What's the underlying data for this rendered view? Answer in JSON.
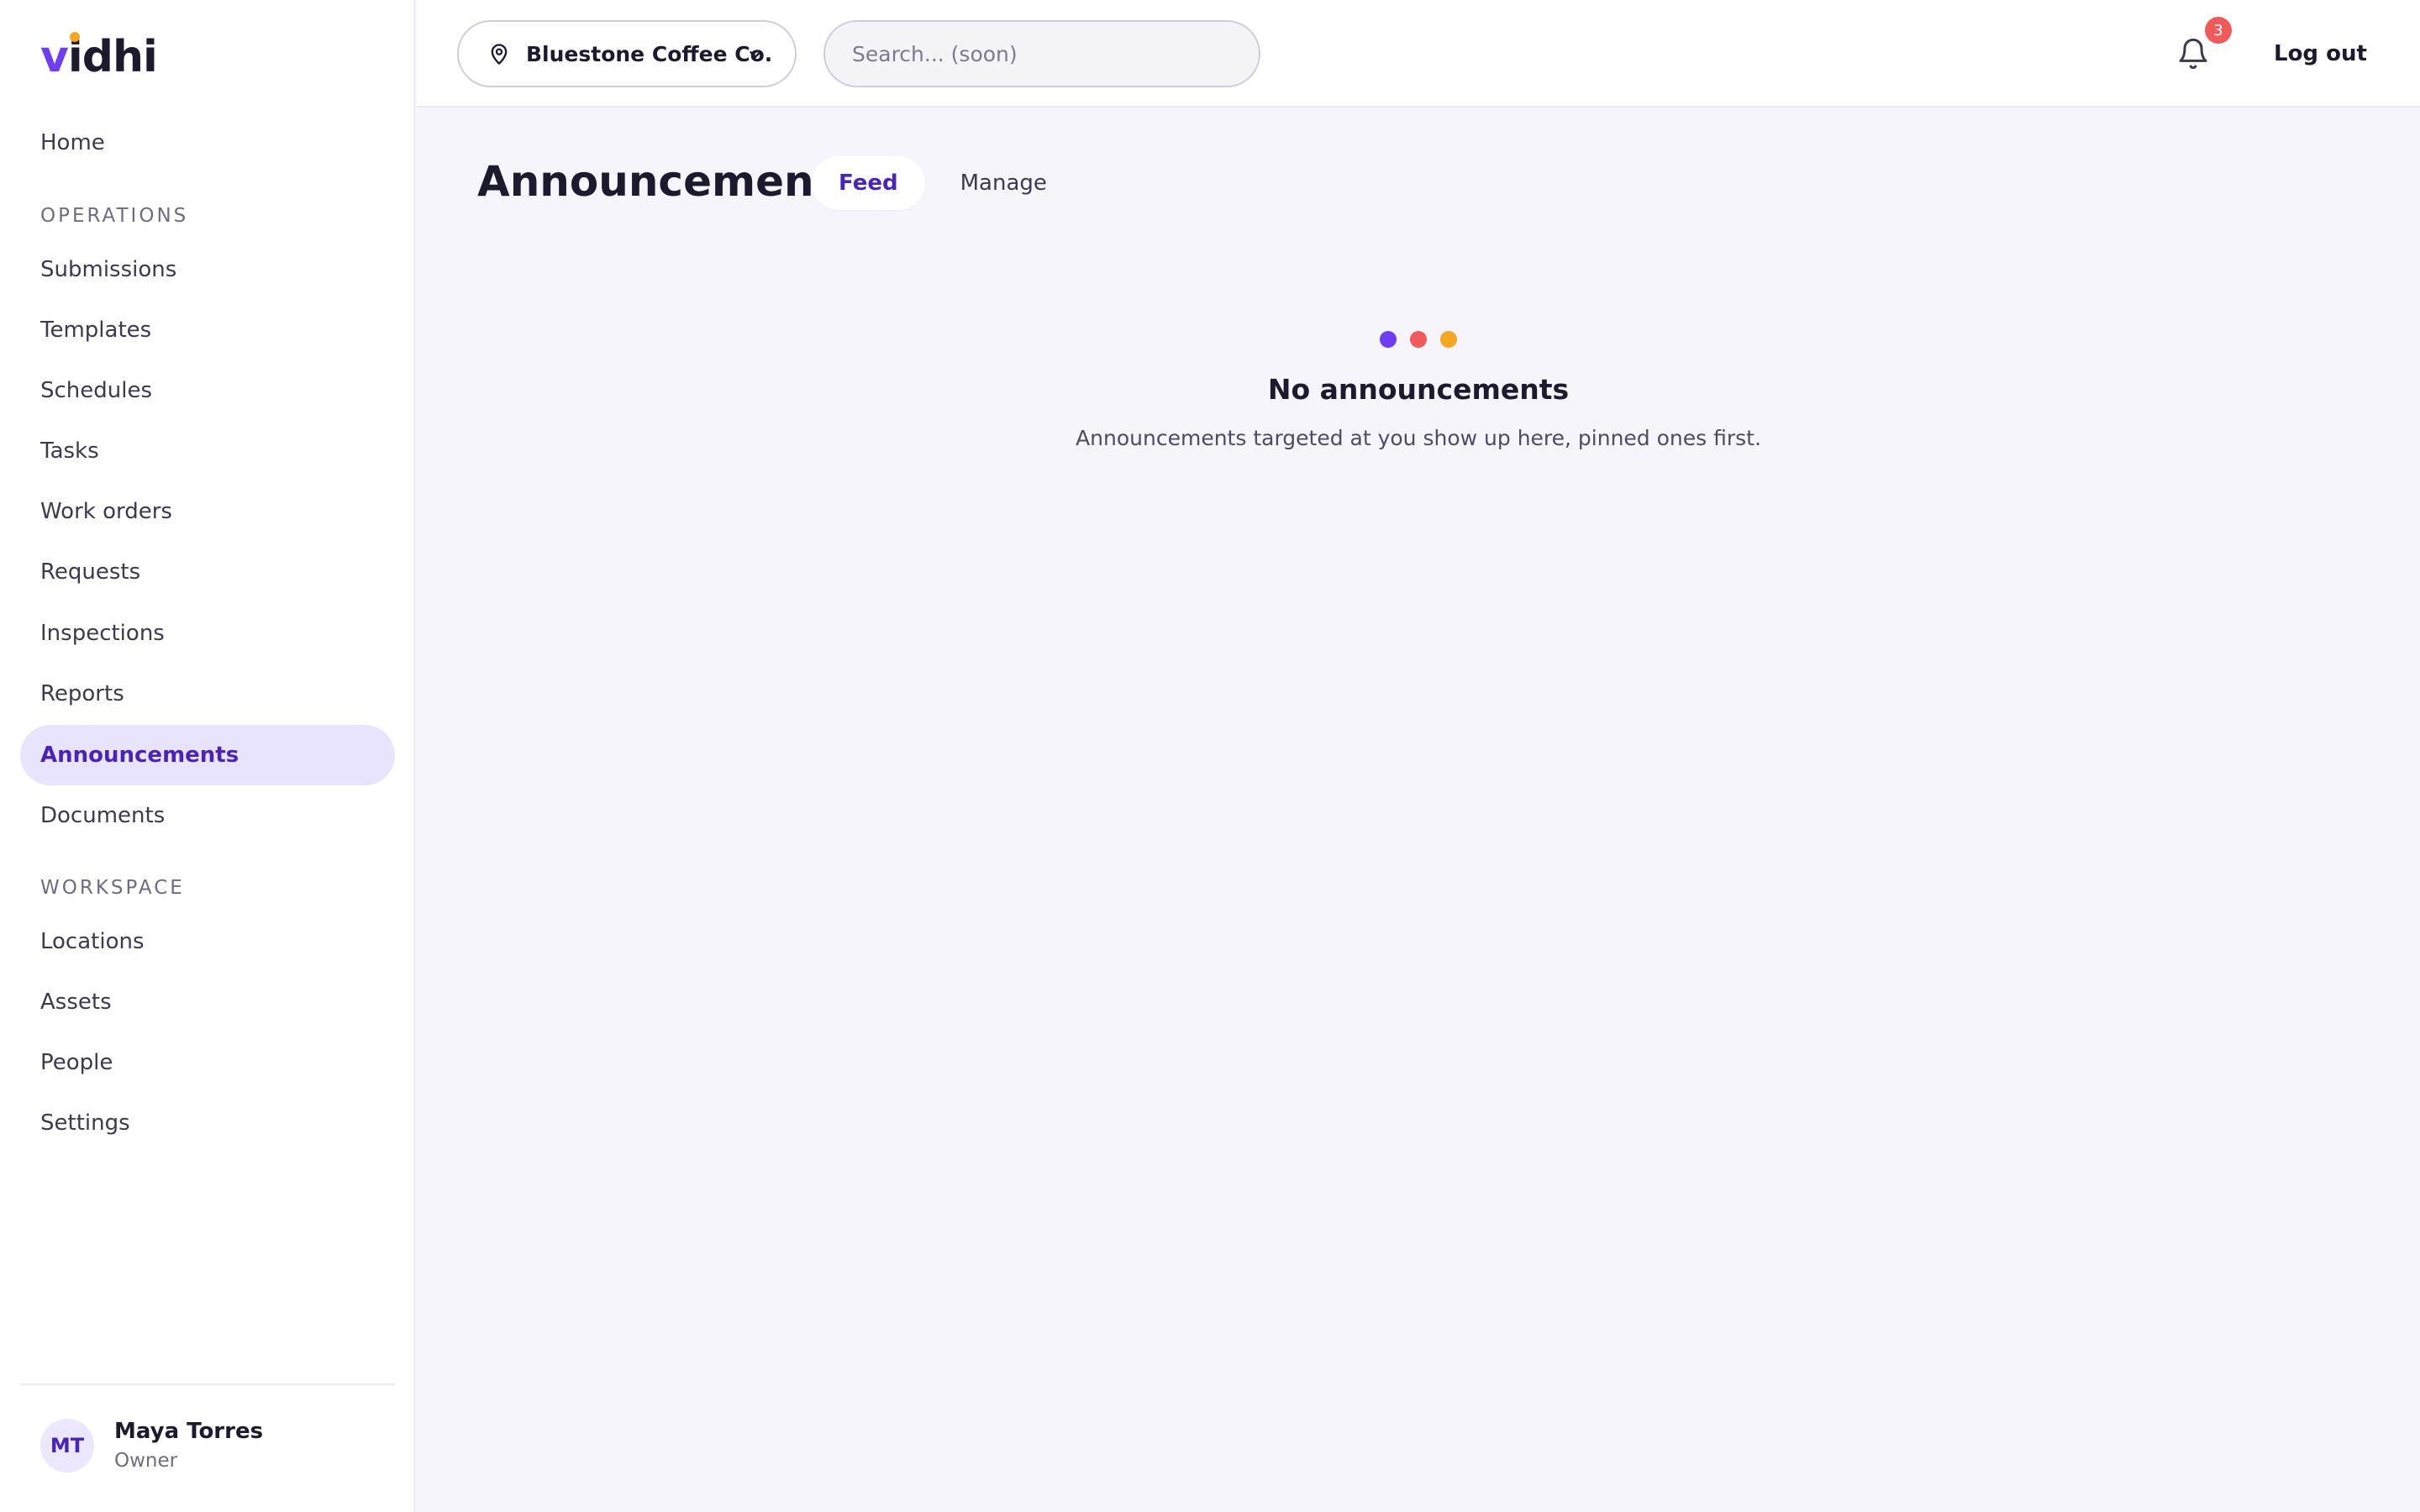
{
  "brand": {
    "logo_v": "v",
    "logo_i": "i",
    "logo_rest": "dhi"
  },
  "topbar": {
    "location_label": "Bluestone Coffee Co.",
    "search_placeholder": "Search... (soon)",
    "notification_count": "3",
    "logout_label": "Log out"
  },
  "sidebar": {
    "home": "Home",
    "sections": [
      {
        "title": "OPERATIONS",
        "items": [
          "Submissions",
          "Templates",
          "Schedules",
          "Tasks",
          "Work orders",
          "Requests",
          "Inspections",
          "Reports",
          "Announcements",
          "Documents"
        ]
      },
      {
        "title": "WORKSPACE",
        "items": [
          "Locations",
          "Assets",
          "People",
          "Settings"
        ]
      }
    ],
    "active_item": "Announcements"
  },
  "user": {
    "initials": "MT",
    "name": "Maya Torres",
    "role": "Owner"
  },
  "main": {
    "title": "Announcements",
    "tabs": [
      {
        "label": "Feed",
        "active": true
      },
      {
        "label": "Manage",
        "active": false
      }
    ],
    "empty_state": {
      "title": "No announcements",
      "description": "Announcements targeted at you show up here, pinned ones first.",
      "dot_colors": [
        "#6d3ff0",
        "#ef5a5a",
        "#f5a623"
      ]
    }
  },
  "colors": {
    "accent": "#6d3ff0",
    "active_bg": "#e9e4fd",
    "badge": "#ef5a5a"
  }
}
